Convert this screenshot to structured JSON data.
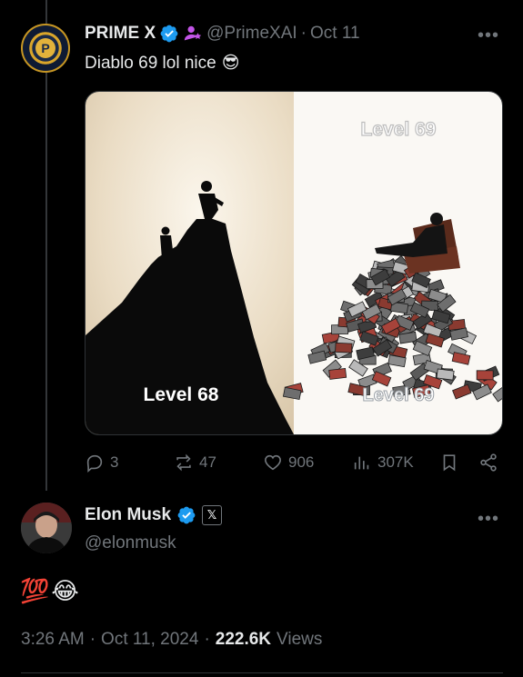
{
  "post1": {
    "author_name": "PRIME X",
    "handle": "@PrimeXAI",
    "date": "Oct 11",
    "text": "Diablo 69 lol nice",
    "emoji": "😎",
    "avatar_icon": "prime-coin-logo",
    "badge_icon": "person-star-icon",
    "media": {
      "left_caption": "Level 68",
      "right_top_caption": "Level 69",
      "right_bottom_caption": "Level 69"
    },
    "actions": {
      "replies": "3",
      "reposts": "47",
      "likes": "906",
      "views": "307K"
    }
  },
  "post2": {
    "author_name": "Elon Musk",
    "handle": "@elonmusk",
    "affiliate_badge": "𝕏",
    "text_emojis": [
      "💯",
      "😂"
    ],
    "time": "3:26 AM",
    "date": "Oct 11, 2024",
    "views_count": "222.6K",
    "views_label": "Views"
  },
  "colors": {
    "background": "#000000",
    "text": "#e7e9ea",
    "muted": "#71767b",
    "verified": "#1d9bf0",
    "badge_purple": "#c355e8"
  }
}
